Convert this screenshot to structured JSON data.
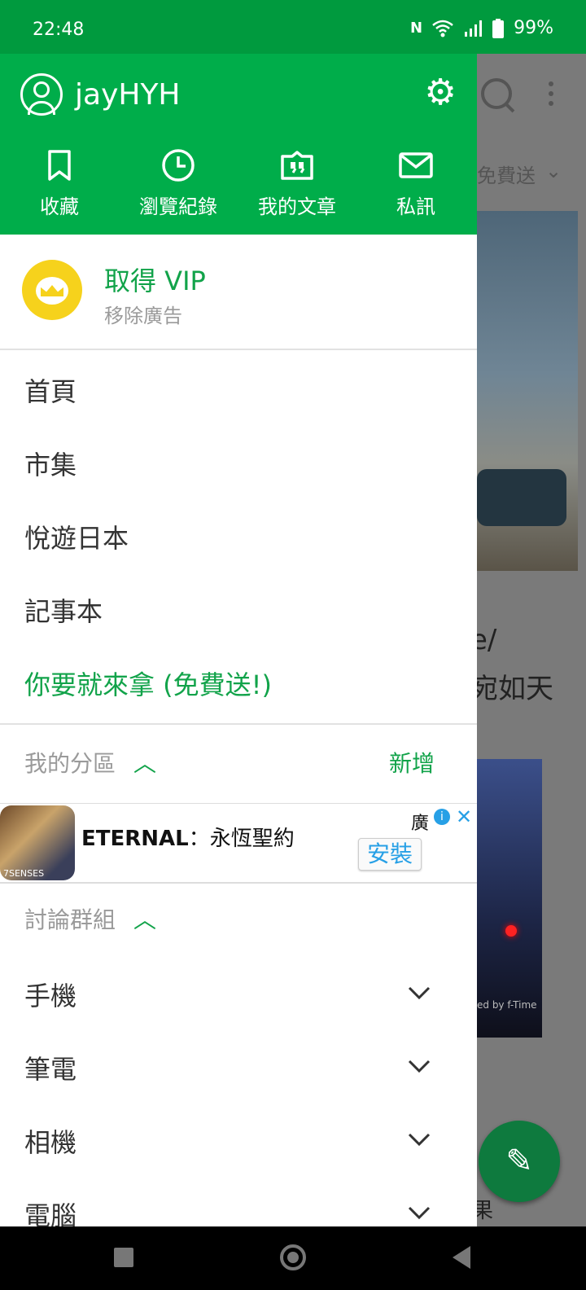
{
  "status_bar": {
    "time": "22:48",
    "nfc": "N",
    "battery": "99%"
  },
  "background_app": {
    "tab_text": "免費送",
    "text_line1": "e/",
    "text_line2": "宛如天",
    "ad_caption": "ed by f-Time",
    "bottom_text": "果"
  },
  "drawer": {
    "username": "jayHYH",
    "quick_links": [
      {
        "label": "收藏",
        "icon": "bookmark-icon"
      },
      {
        "label": "瀏覽紀錄",
        "icon": "history-clock-icon"
      },
      {
        "label": "我的文章",
        "icon": "quote-article-icon"
      },
      {
        "label": "私訊",
        "icon": "mail-icon"
      }
    ],
    "vip": {
      "title": "取得 VIP",
      "subtitle": "移除廣告"
    },
    "menu": [
      "首頁",
      "市集",
      "悅遊日本",
      "記事本"
    ],
    "promo": "你要就來拿 (免費送!)",
    "my_sections": {
      "label": "我的分區",
      "add_label": "新增"
    },
    "ad": {
      "app_title": "ETERNAL",
      "app_subtitle": "：永恆聖約",
      "ad_label": "廣",
      "install_label": "安裝",
      "publisher_badge": "7SENSES"
    },
    "groups": {
      "label": "討論群組",
      "items": [
        "手機",
        "筆電",
        "相機",
        "電腦"
      ]
    }
  },
  "colors": {
    "header_green": "#00ad4a",
    "accent_green": "#12a34a",
    "status_green": "#009a3e"
  }
}
